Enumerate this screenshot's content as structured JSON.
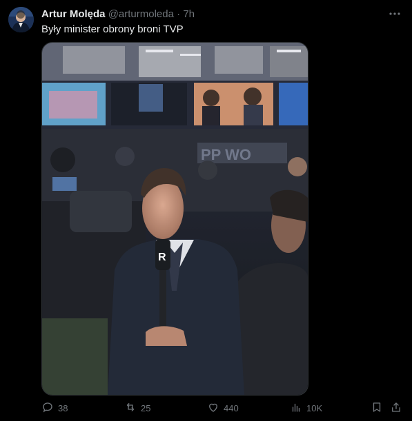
{
  "tweet": {
    "author_name": "Artur Molęda",
    "author_handle": "@arturmoleda",
    "separator": "·",
    "time": "7h",
    "text": "Były minister obrony broni TVP"
  },
  "actions": {
    "replies": "38",
    "reposts": "25",
    "likes": "440",
    "views": "10K"
  },
  "icons": {
    "more": "more-icon",
    "reply": "reply-icon",
    "repost": "repost-icon",
    "like": "heart-icon",
    "views": "analytics-icon",
    "bookmark": "bookmark-icon",
    "share": "share-icon"
  },
  "photo": {
    "sign_text": "PP  WO",
    "mic_flag": "R"
  }
}
